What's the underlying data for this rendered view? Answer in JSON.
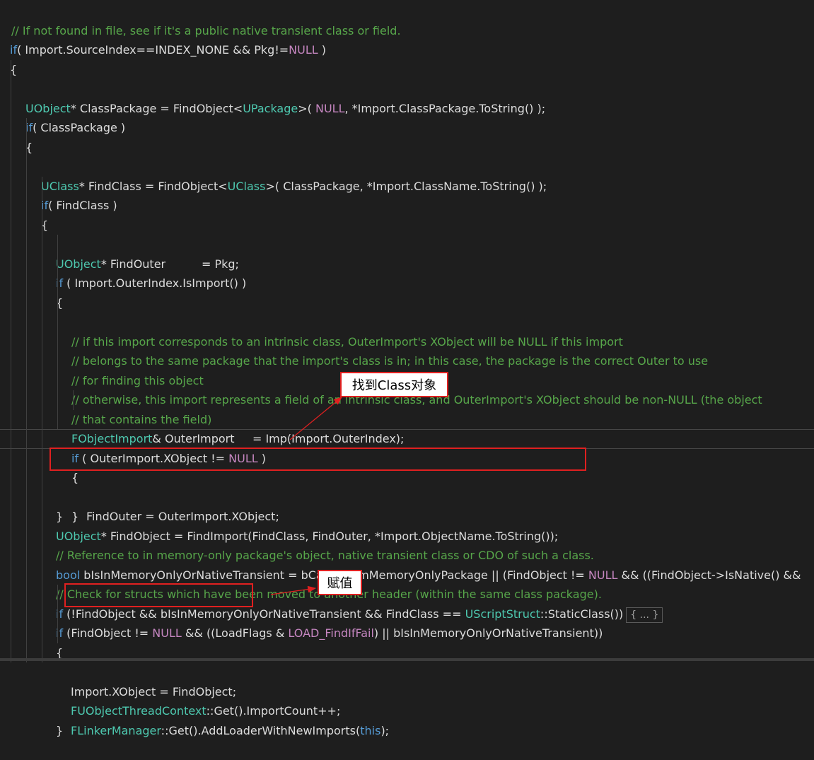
{
  "code": {
    "l01": [
      "// If not found in file, see if it's a public native transient class or field."
    ],
    "l02": [
      "if",
      "( Import.SourceIndex==INDEX_NONE && Pkg!=",
      "NULL",
      " )"
    ],
    "l03": [
      "{"
    ],
    "l04": [
      "UObject",
      "* ClassPackage = FindObject<",
      "UPackage",
      ">( ",
      "NULL",
      ", *Import.ClassPackage.ToString() );"
    ],
    "l05": [
      "if",
      "( ClassPackage )"
    ],
    "l06": [
      "{"
    ],
    "l07": [
      "UClass",
      "* FindClass = FindObject<",
      "UClass",
      ">( ClassPackage, *Import.ClassName.ToString() );"
    ],
    "l08": [
      "if",
      "( FindClass )"
    ],
    "l09": [
      "{"
    ],
    "l10": [
      "UObject",
      "* FindOuter          = Pkg;"
    ],
    "l11": [
      "if",
      " ( Import.OuterIndex.IsImport() )"
    ],
    "l12": [
      "{"
    ],
    "l13": [
      "// if this import corresponds to an intrinsic class, OuterImport's XObject will be NULL if this import"
    ],
    "l14": [
      "// belongs to the same package that the import's class is in; in this case, the package is the correct Outer to use"
    ],
    "l15": [
      "// for finding this object"
    ],
    "l16": [
      "// otherwise, this import represents a field of an intrinsic class, and OuterImport's XObject should be non-NULL (the object"
    ],
    "l17": [
      "// that contains the field)"
    ],
    "l18": [
      "FObjectImport",
      "& OuterImport     = Imp(Import.OuterIndex);"
    ],
    "l19": [
      "if",
      " ( OuterImport.XObject != ",
      "NULL",
      " )"
    ],
    "l20": [
      "{"
    ],
    "l21": [
      "FindOuter = OuterImport.XObject;"
    ],
    "l22": [
      "}"
    ],
    "l23": [
      "}"
    ],
    "l24": [
      "UObject",
      "* FindObject = FindImport(FindClass, FindOuter, *Import.ObjectName.ToString());"
    ],
    "l25": [
      "// Reference to in memory-only package's object, native transient class or CDO of such a class."
    ],
    "l26": [
      "bool",
      " bIsInMemoryOnlyOrNativeTransient = bCameFromMemoryOnlyPackage || (FindObject != ",
      "NULL",
      " && ((FindObject->IsNative() &&"
    ],
    "l27": [
      "// Check for structs which have been moved to another header (within the same class package)."
    ],
    "l28": [
      "if",
      " (!FindObject && bIsInMemoryOnlyOrNativeTransient && FindClass == ",
      "UScriptStruct",
      "::StaticClass())",
      "{ ... }"
    ],
    "l29": [
      "if",
      " (FindObject != ",
      "NULL",
      " && ((LoadFlags & ",
      "LOAD_FindIfFail",
      ") || bIsInMemoryOnlyOrNativeTransient))"
    ],
    "l30": [
      "{"
    ],
    "l31": [
      "Import.XObject = FindObject;"
    ],
    "l32": [
      "FUObjectThreadContext",
      "::Get().ImportCount++;"
    ],
    "l33": [
      "FLinkerManager",
      "::Get().AddLoaderWithNewImports(",
      "this",
      ");"
    ],
    "l34": [
      "}"
    ]
  },
  "annotations": {
    "find_class_note": "找到Class对象",
    "assign_note": "赋值"
  },
  "colors": {
    "background": "#1e1e1e",
    "comment": "#57a64a",
    "keyword": "#569cd6",
    "type": "#4ec9b0",
    "macro": "#c586c0",
    "annotation_border": "#e02020"
  }
}
